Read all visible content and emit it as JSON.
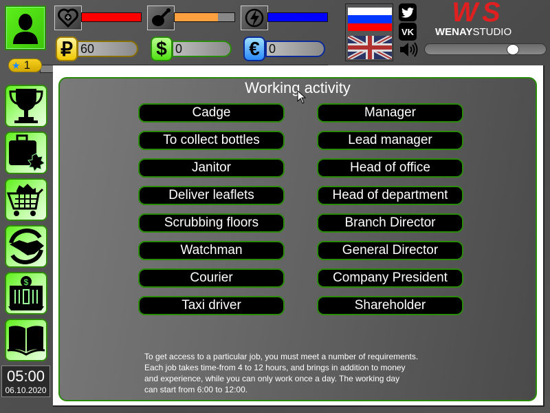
{
  "player": {
    "level": "1",
    "xp_fraction": 0.0
  },
  "stats": {
    "health": {
      "icon": "heart-plus-icon",
      "fill": 1.0,
      "color": "#ff0000"
    },
    "food": {
      "icon": "chicken-leg-icon",
      "fill": 0.72,
      "color": "#ffa040"
    },
    "energy": {
      "icon": "lightning-icon",
      "fill": 1.0,
      "color": "#0000ff"
    }
  },
  "currencies": {
    "ruble": {
      "symbol": "₽",
      "value": "60",
      "color": "#f5d020"
    },
    "dollar": {
      "symbol": "$",
      "value": "0",
      "color": "#66ee33"
    },
    "euro": {
      "symbol": "€",
      "value": "0",
      "color": "#3aa0ff"
    }
  },
  "languages": [
    "Russian",
    "English"
  ],
  "social": {
    "twitter": "twitter-icon",
    "vk": "VK"
  },
  "brand": {
    "logo_mark": "WS",
    "name_bold": "WENAY",
    "name_light": "STUDIO"
  },
  "volume": {
    "level": 0.75
  },
  "sidebar": [
    {
      "name": "achievements",
      "icon": "trophy-icon"
    },
    {
      "name": "work",
      "icon": "briefcase-icon"
    },
    {
      "name": "shop",
      "icon": "shopping-cart-icon"
    },
    {
      "name": "deals",
      "icon": "handshake-icon"
    },
    {
      "name": "bank",
      "icon": "bank-icon"
    },
    {
      "name": "education",
      "icon": "book-icon"
    }
  ],
  "clock": {
    "time": "05:00",
    "date": "06.10.2020"
  },
  "main": {
    "title": "Working activity",
    "jobs_left": [
      "Cadge",
      "To collect bottles",
      "Janitor",
      "Deliver leaflets",
      "Scrubbing floors",
      "Watchman",
      "Courier",
      "Taxi driver"
    ],
    "jobs_right": [
      "Manager",
      "Lead manager",
      "Head of office",
      "Head of department",
      "Branch Director",
      "General Director",
      "Company President",
      "Shareholder"
    ],
    "info_lines": [
      "To get access to a particular job, you must meet a number of requirements.",
      "Each job takes time-from 4 to 12 hours, and brings in addition to money",
      "and experience, while you can only work once a day. The working day",
      "can start from 6:00 to 12:00."
    ]
  }
}
